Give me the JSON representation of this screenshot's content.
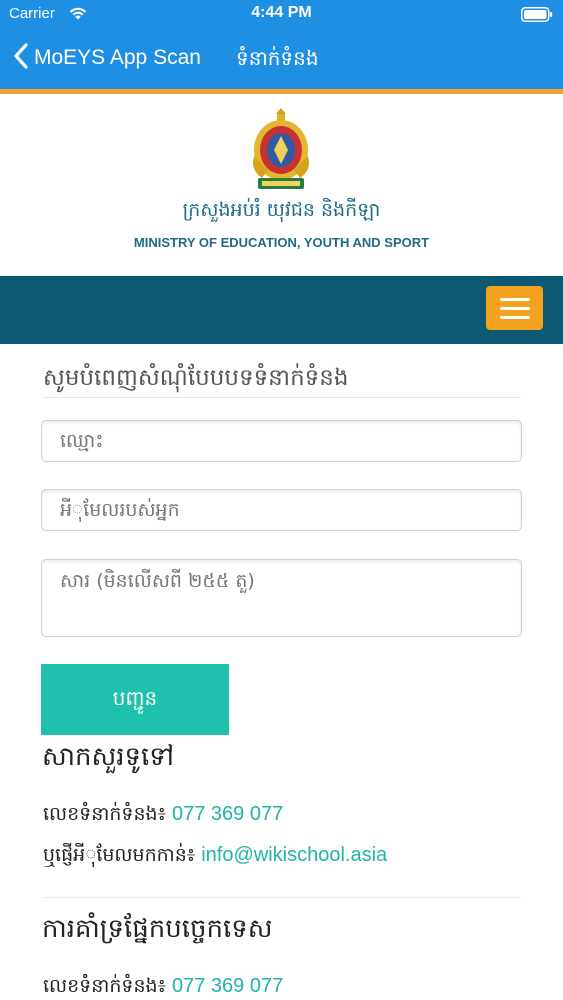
{
  "status_bar": {
    "carrier": "Carrier",
    "time": "4:44 PM"
  },
  "nav": {
    "back_label": "MoEYS App Scan",
    "title": "ទំនាក់ទំនង",
    "bar_color": "#1f8fe3",
    "accent_strip_color": "#f2a42a"
  },
  "header": {
    "ministry_khmer": "ក្រសួងអប់រំ យុវជន និងកីឡា",
    "ministry_english": "MINISTRY OF EDUCATION, YOUTH AND SPORT",
    "emblem_icon": "ministry-emblem"
  },
  "menu_band": {
    "color": "#0c5a73",
    "menu_button_icon": "hamburger-icon",
    "menu_button_color": "#f2a21e"
  },
  "form": {
    "title": "សូមបំពេញសំណុំបែបបទទំនាក់ទំនង",
    "name_placeholder": "ឈ្មោះ",
    "email_placeholder": "អីុមែលរបស់អ្នក",
    "message_placeholder": "សារ (មិនលើសពី ២៥៥ តួ)",
    "submit_label": "បញ្ជូន",
    "submit_color": "#1fc0ad"
  },
  "general": {
    "heading": "សាកសួរទូទៅ",
    "phone_label": "លេខទំនាក់ទំនង៖",
    "phone_value": "077 369 077",
    "email_label": "ឬផ្ញើអីុមែលមកកាន់៖",
    "email_value": "info@wikischool.asia"
  },
  "tech_support": {
    "heading": "ការគាំទ្រផ្នែកបច្ចេកទេស",
    "phone_label": "លេខទំនាក់ទំនង៖",
    "phone_value": "077 369 077"
  },
  "link_color": "#1fb5a6"
}
